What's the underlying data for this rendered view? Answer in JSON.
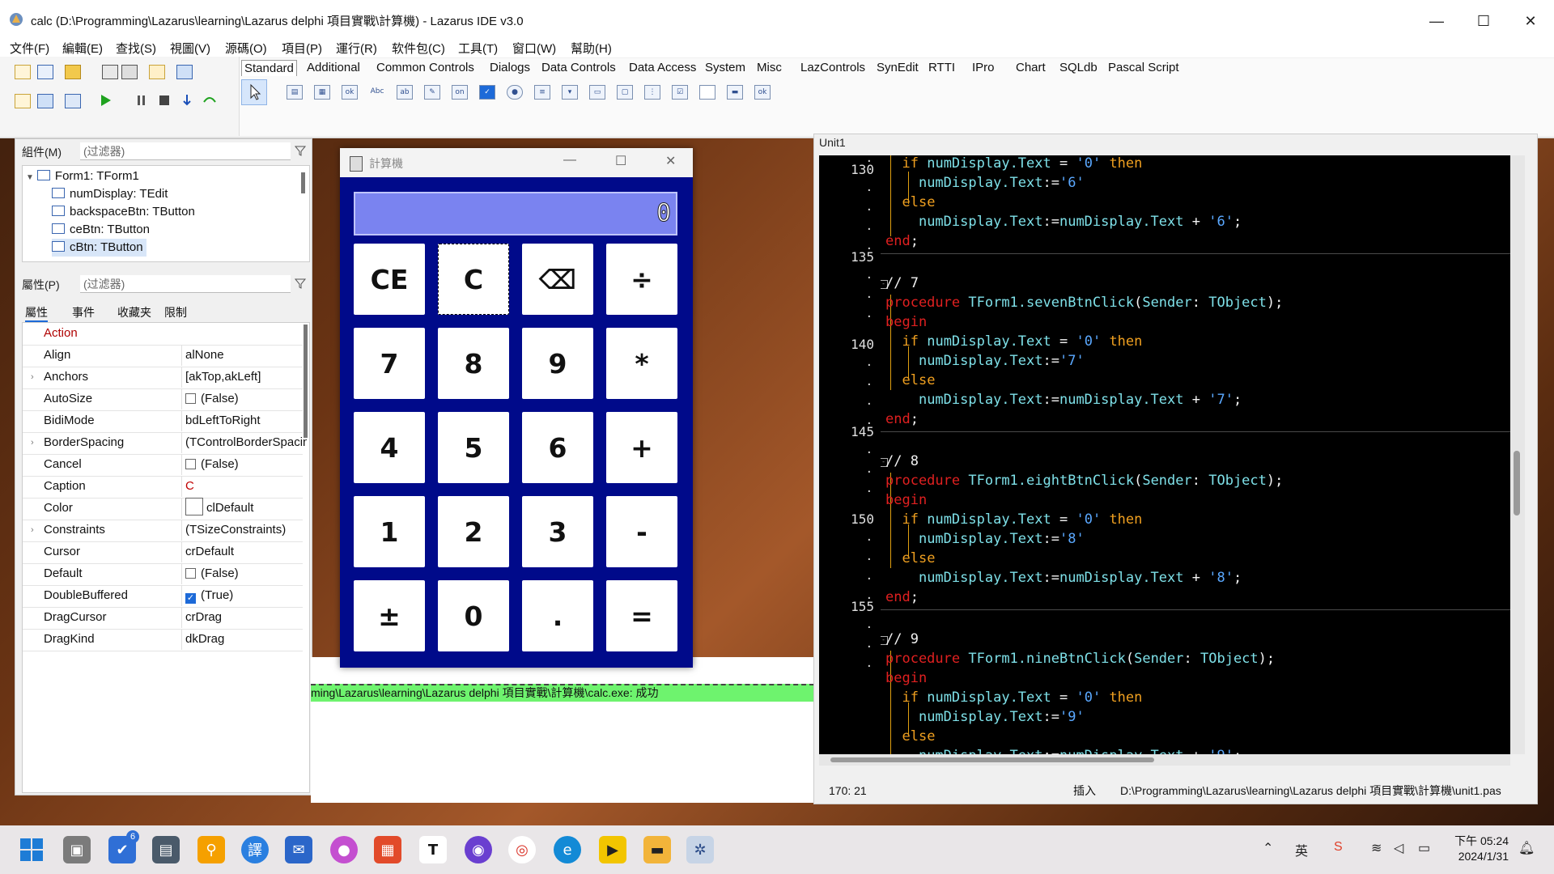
{
  "window": {
    "title": "calc (D:\\Programming\\Lazarus\\learning\\Lazarus delphi 項目實戰\\計算機) - Lazarus IDE v3.0",
    "minimize": "—",
    "maximize": "☐",
    "close": "✕"
  },
  "menu": [
    "文件(F)",
    "編輯(E)",
    "查找(S)",
    "視圖(V)",
    "源碼(O)",
    "項目(P)",
    "運行(R)",
    "软件包(C)",
    "工具(T)",
    "窗口(W)",
    "幫助(H)"
  ],
  "palette": {
    "tabs": [
      "Standard",
      "Additional",
      "Common Controls",
      "Dialogs",
      "Data Controls",
      "Data Access",
      "System",
      "Misc",
      "LazControls",
      "SynEdit",
      "RTTI",
      "IPro",
      "Chart",
      "SQLdb",
      "Pascal Script"
    ],
    "active_tab": "Standard"
  },
  "inspector": {
    "components_label": "組件(M)",
    "components_filter": "(过滤器)",
    "tree": [
      {
        "text": "Form1: TForm1",
        "depth": 0
      },
      {
        "text": "numDisplay: TEdit",
        "depth": 1
      },
      {
        "text": "backspaceBtn: TButton",
        "depth": 1
      },
      {
        "text": "ceBtn: TButton",
        "depth": 1
      },
      {
        "text": "cBtn: TButton",
        "depth": 1,
        "selected": true
      }
    ],
    "props_label": "屬性(P)",
    "props_filter": "(过滤器)",
    "tabs": [
      "屬性",
      "事件",
      "收藏夹",
      "限制"
    ],
    "properties": [
      {
        "name": "Action",
        "value": "",
        "red": true
      },
      {
        "name": "Align",
        "value": "alNone"
      },
      {
        "name": "Anchors",
        "value": "[akTop,akLeft]",
        "expand": true
      },
      {
        "name": "AutoSize",
        "value": "(False)",
        "check": "off"
      },
      {
        "name": "BidiMode",
        "value": "bdLeftToRight"
      },
      {
        "name": "BorderSpacing",
        "value": "(TControlBorderSpacing)",
        "expand": true
      },
      {
        "name": "Cancel",
        "value": "(False)",
        "check": "off"
      },
      {
        "name": "Caption",
        "value": "C",
        "red": true
      },
      {
        "name": "Color",
        "value": "clDefault",
        "swatch": true
      },
      {
        "name": "Constraints",
        "value": "(TSizeConstraints)",
        "expand": true
      },
      {
        "name": "Cursor",
        "value": "crDefault"
      },
      {
        "name": "Default",
        "value": "(False)",
        "check": "off"
      },
      {
        "name": "DoubleBuffered",
        "value": "(True)",
        "check": "on"
      },
      {
        "name": "DragCursor",
        "value": "crDrag"
      },
      {
        "name": "DragKind",
        "value": "dkDrag"
      }
    ]
  },
  "messages": {
    "success_line": "ming\\Lazarus\\learning\\Lazarus delphi 項目實戰\\計算機\\calc.exe: 成功"
  },
  "calculator": {
    "title": "計算機",
    "display": "0",
    "buttons": [
      [
        "CE",
        "C",
        "⌫",
        "÷"
      ],
      [
        "7",
        "8",
        "9",
        "*"
      ],
      [
        "4",
        "5",
        "6",
        "+"
      ],
      [
        "1",
        "2",
        "3",
        "-"
      ],
      [
        "±",
        "0",
        ".",
        "="
      ]
    ]
  },
  "editor": {
    "tab": "Unit1",
    "status_pos": "170: 21",
    "status_mode": "插入",
    "status_path": "D:\\Programming\\Lazarus\\learning\\Lazarus delphi 項目實戰\\計算機\\unit1.pas",
    "line_numbers": [
      "130",
      "135",
      "140",
      "145",
      "150",
      "155"
    ]
  },
  "taskbar": {
    "time": "下午 05:24",
    "date": "2024/1/31",
    "lang": "英",
    "badge": "6"
  }
}
